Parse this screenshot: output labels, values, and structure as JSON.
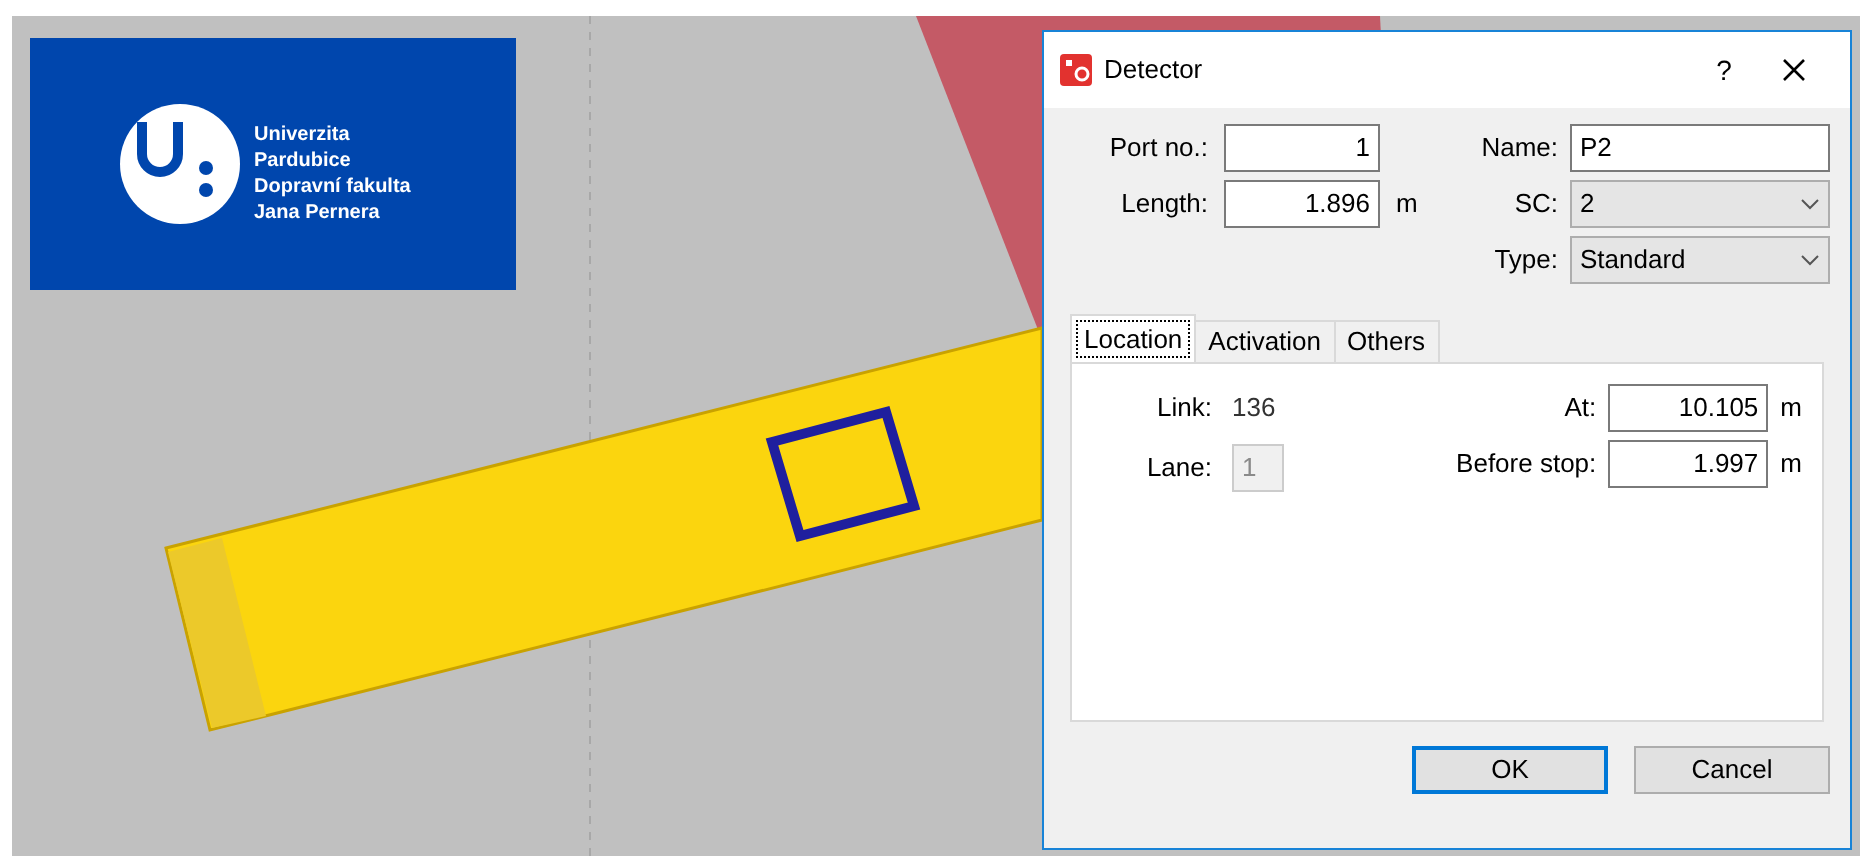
{
  "logo": {
    "lines": [
      "Univerzita",
      "Pardubice",
      "Dopravní fakulta",
      "Jana Pernera"
    ]
  },
  "dialog": {
    "title": "Detector",
    "help": "?",
    "port_no": {
      "label": "Port no.:",
      "value": "1"
    },
    "length": {
      "label": "Length:",
      "value": "1.896",
      "unit": "m"
    },
    "name": {
      "label": "Name:",
      "value": "P2"
    },
    "sc": {
      "label": "SC:",
      "value": "2"
    },
    "type": {
      "label": "Type:",
      "value": "Standard"
    },
    "tabs": [
      {
        "label": "Location",
        "selected": true
      },
      {
        "label": "Activation",
        "selected": false
      },
      {
        "label": "Others",
        "selected": false
      }
    ],
    "location": {
      "link": {
        "label": "Link:",
        "value": "136"
      },
      "lane": {
        "label": "Lane:",
        "value": "1",
        "disabled": true
      },
      "at": {
        "label": "At:",
        "value": "10.105",
        "unit": "m"
      },
      "before_stop": {
        "label": "Before stop:",
        "value": "1.997",
        "unit": "m"
      }
    },
    "buttons": [
      {
        "label": "OK",
        "default": true
      },
      {
        "label": "Cancel",
        "default": false
      }
    ]
  }
}
